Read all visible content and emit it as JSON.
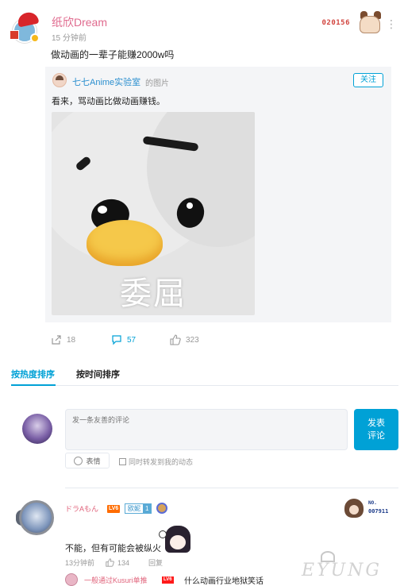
{
  "post": {
    "username": "纸欣Dream",
    "time": "15 分钟前",
    "fan_number": "020156",
    "menu_glyph": "⋮",
    "text": "做动画的一辈子能赚2000w吗"
  },
  "repost": {
    "source_name": "七七Anime实验室",
    "source_suffix": "的图片",
    "follow_label": "关注",
    "text": "看来，骂动画比做动画赚钱。",
    "image_caption": "委屈"
  },
  "actions": {
    "share_count": "18",
    "comment_count": "57",
    "like_count": "323"
  },
  "sort_tabs": {
    "hot": "按热度排序",
    "time": "按时间排序"
  },
  "comment_box": {
    "placeholder": "发一条友善的评论",
    "submit_label": "发表\n评论",
    "emoji_label": "表情",
    "repost_label": "同时转发到我的动态"
  },
  "comments": [
    {
      "username": "ドラAもん",
      "level": "LV6",
      "medal_name": "欧妮",
      "medal_level": "1",
      "fan_label": "NO.",
      "fan_number": "007911",
      "text": "不能，但有可能会被纵火",
      "time": "13分钟前",
      "likes": "134",
      "reply_label": "回复",
      "reply_preview": {
        "username": "一般通过Kusuri单推",
        "level": "LV6",
        "text": "什么动画行业地狱笑话"
      }
    }
  ],
  "watermark": "EYUNG",
  "colors": {
    "accent": "#00a1d6",
    "username_pink": "#e0637b",
    "level_orange": "#ff6c00",
    "card_bg": "#f4f5f7",
    "fan_red": "#d2453f"
  },
  "icons": [
    "share-icon",
    "comment-icon",
    "like-icon",
    "more-icon",
    "smile-icon"
  ]
}
